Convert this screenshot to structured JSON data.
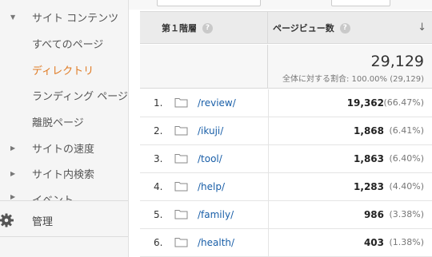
{
  "sidebar": {
    "items": [
      {
        "label": "サイト コンテンツ",
        "arrow": "▼",
        "active": false
      },
      {
        "label": "すべてのページ",
        "arrow": "",
        "active": false
      },
      {
        "label": "ディレクトリ",
        "arrow": "",
        "active": true
      },
      {
        "label": "ランディング ページ",
        "arrow": "",
        "active": false
      },
      {
        "label": "離脱ページ",
        "arrow": "",
        "active": false
      },
      {
        "label": "サイトの速度",
        "arrow": "▶",
        "active": false
      },
      {
        "label": "サイト内検索",
        "arrow": "▶",
        "active": false
      },
      {
        "label": "イベント",
        "arrow": "▶",
        "active": false
      }
    ],
    "admin_label": "管理"
  },
  "table": {
    "dimension_header": "第１階層",
    "metric_header": "ページビュー数",
    "help_glyph": "?",
    "sort_glyph": "↓",
    "total_value": "29,129",
    "total_subtext": "全体に対する割合: 100.00% (29,129)",
    "rows": [
      {
        "rank": "1.",
        "path": "/review/",
        "pageviews": "19,362",
        "percent": "(66.47%)"
      },
      {
        "rank": "2.",
        "path": "/ikuji/",
        "pageviews": "1,868",
        "percent": "(6.41%)"
      },
      {
        "rank": "3.",
        "path": "/tool/",
        "pageviews": "1,863",
        "percent": "(6.40%)"
      },
      {
        "rank": "4.",
        "path": "/help/",
        "pageviews": "1,283",
        "percent": "(4.40%)"
      },
      {
        "rank": "5.",
        "path": "/family/",
        "pageviews": "986",
        "percent": "(3.38%)"
      },
      {
        "rank": "6.",
        "path": "/health/",
        "pageviews": "403",
        "percent": "(1.38%)"
      }
    ]
  },
  "colors": {
    "active_nav": "#e07b24",
    "link": "#1a5fa8",
    "header_bg": "#ebebeb"
  },
  "icons": {
    "row_icon": "folder-icon",
    "admin_icon": "gear-icon"
  }
}
